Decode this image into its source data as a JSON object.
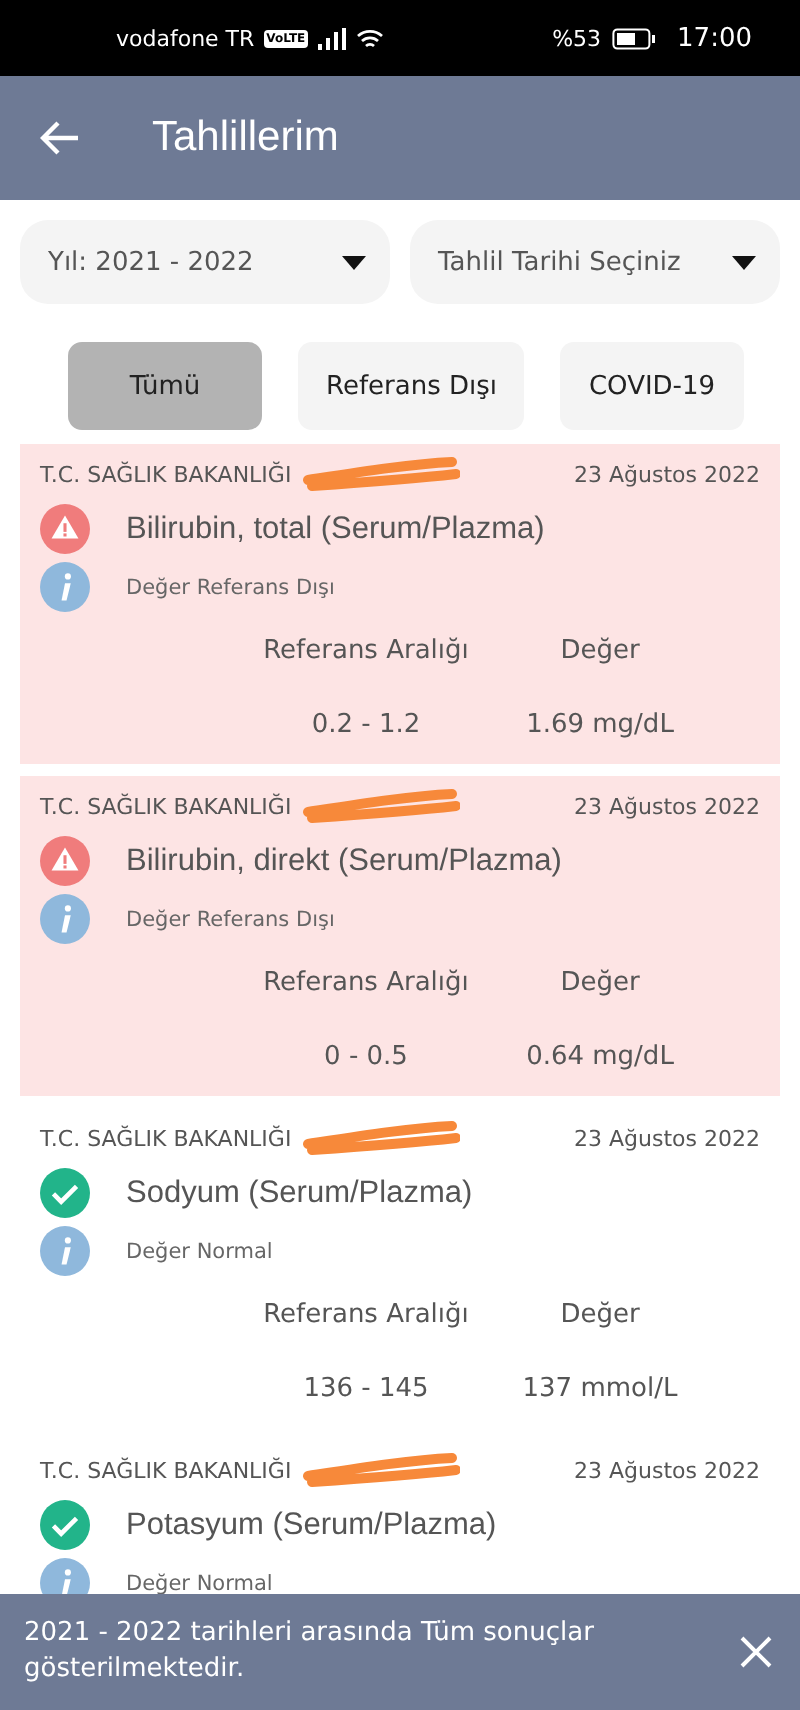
{
  "status_bar": {
    "carrier": "vodafone TR",
    "network_badge": "VoLTE",
    "battery": "%53",
    "time": "17:00"
  },
  "header": {
    "title": "Tahlillerim"
  },
  "filters": [
    {
      "label": "Yıl: 2021 - 2022"
    },
    {
      "label": "Tahlil Tarihi Seçiniz"
    }
  ],
  "tabs": [
    {
      "label": "Tümü",
      "selected": true
    },
    {
      "label": "Referans Dışı",
      "selected": false
    },
    {
      "label": "COVID-19",
      "selected": false
    }
  ],
  "results": [
    {
      "kind": "abnormal",
      "institution": "T.C. SAĞLIK BAKANLIĞI",
      "date": "23 Ağustos 2022",
      "test": "Bilirubin, total (Serum/Plazma)",
      "note": "Değer Referans Dışı",
      "range_label": "Referans Aralığı",
      "value_label": "Değer",
      "range": "0.2 - 1.2",
      "value": "1.69 mg/dL"
    },
    {
      "kind": "abnormal",
      "institution": "T.C. SAĞLIK BAKANLIĞI",
      "date": "23 Ağustos 2022",
      "test": "Bilirubin, direkt (Serum/Plazma)",
      "note": "Değer Referans Dışı",
      "range_label": "Referans Aralığı",
      "value_label": "Değer",
      "range": "0 - 0.5",
      "value": "0.64 mg/dL"
    },
    {
      "kind": "normal",
      "institution": "T.C. SAĞLIK BAKANLIĞI",
      "date": "23 Ağustos 2022",
      "test": "Sodyum (Serum/Plazma)",
      "note": "Değer Normal",
      "range_label": "Referans Aralığı",
      "value_label": "Değer",
      "range": "136 - 145",
      "value": "137 mmol/L"
    },
    {
      "kind": "normal",
      "institution": "T.C. SAĞLIK BAKANLIĞI",
      "date": "23 Ağustos 2022",
      "test": "Potasyum (Serum/Plazma)",
      "note": "Değer Normal"
    }
  ],
  "snackbar": {
    "message": "2021 - 2022 tarihleri arasında Tüm sonuçlar gösterilmektedir."
  }
}
